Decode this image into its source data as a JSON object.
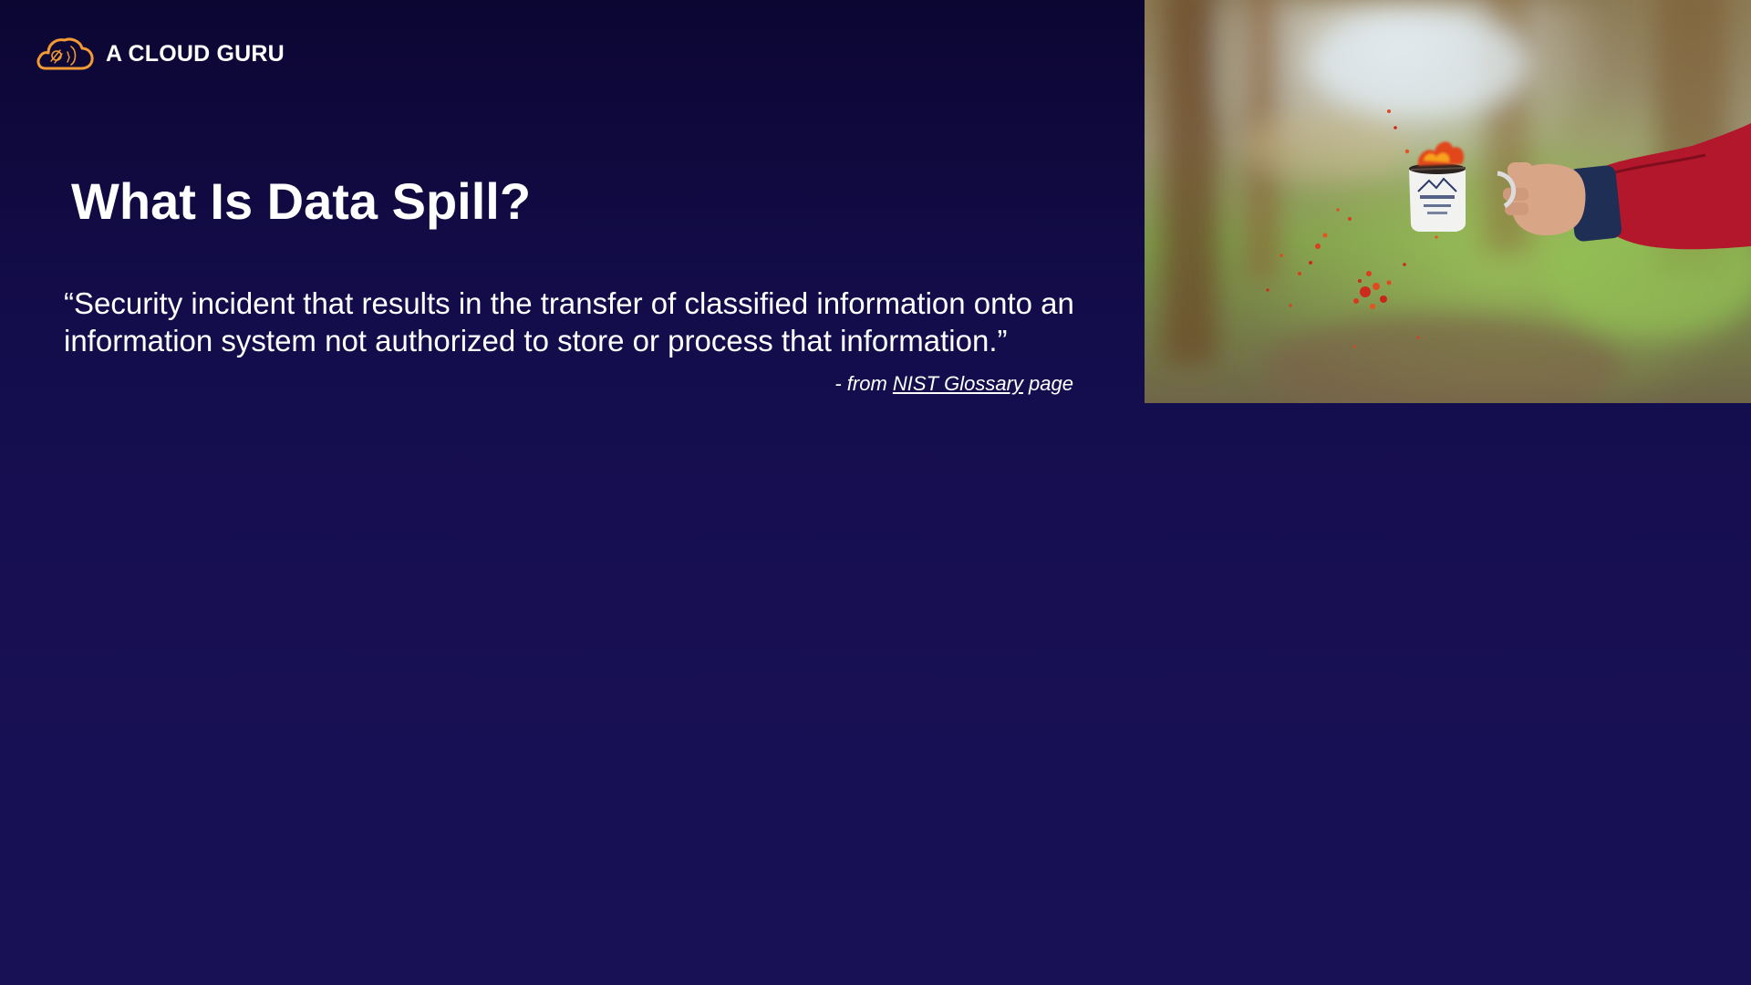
{
  "brand": {
    "logo_text": "A CLOUD GURU",
    "logo_icon": "cloud-icon",
    "accent_color": "#f29a33"
  },
  "slide": {
    "title": "What Is Data Spill?",
    "quote": "“Security incident that results in the transfer of classified information onto an information system not authorized to store or process that information.”",
    "attribution": {
      "prefix": "- from ",
      "link_text": "NIST Glossary",
      "suffix": " page"
    }
  },
  "colors": {
    "background_top": "#0c0633",
    "background_bottom": "#191156",
    "text": "#ffffff"
  }
}
